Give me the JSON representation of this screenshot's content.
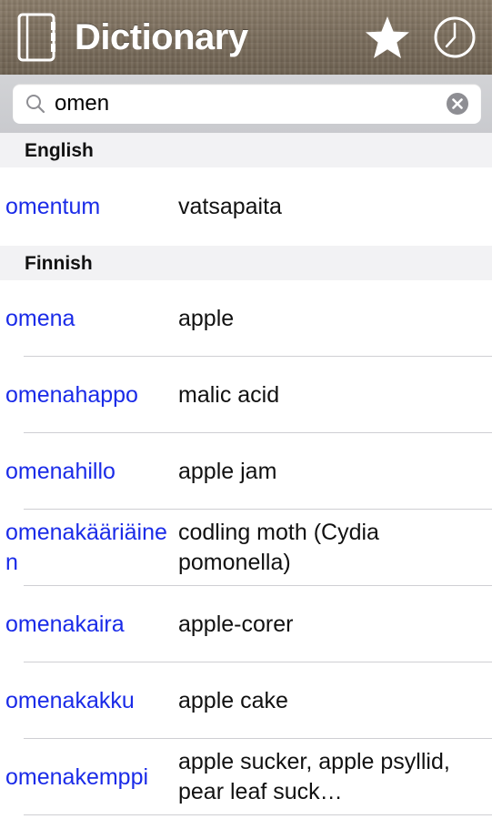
{
  "header": {
    "title": "Dictionary",
    "icons": {
      "app": "notebook-icon",
      "favorites": "star-icon",
      "history": "clock-icon"
    }
  },
  "search": {
    "value": "omen",
    "placeholder": "Search",
    "icons": {
      "search": "magnifier-icon",
      "clear": "clear-x-icon"
    }
  },
  "sections": [
    {
      "label": "English",
      "entries": [
        {
          "term": "omentum",
          "definition": "vatsapaita"
        }
      ]
    },
    {
      "label": "Finnish",
      "entries": [
        {
          "term": "omena",
          "definition": "apple"
        },
        {
          "term": "omenahappo",
          "definition": "malic acid"
        },
        {
          "term": "omenahillo",
          "definition": "apple jam"
        },
        {
          "term": "omenakääriäinen",
          "definition": "codling moth (Cydia pomonella)"
        },
        {
          "term": "omenakaira",
          "definition": "apple-corer"
        },
        {
          "term": "omenakakku",
          "definition": "apple cake"
        },
        {
          "term": "omenakemppi",
          "definition": "apple sucker, apple psyllid, pear leaf suck…"
        }
      ]
    }
  ],
  "colors": {
    "term": "#1a2be8",
    "definition": "#111111",
    "section_header_bg": "#f2f2f4",
    "header_bg": "#7a6d5c"
  }
}
